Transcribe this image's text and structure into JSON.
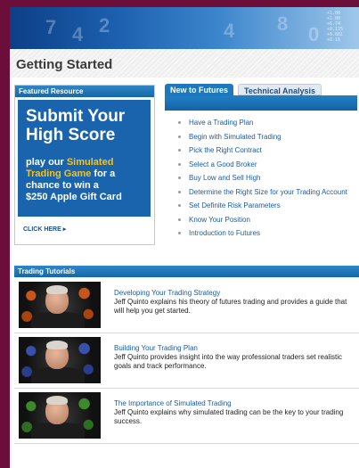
{
  "page_title": "Getting Started",
  "banner": {
    "ticker": [
      "+1.00",
      "+1.00",
      "+6.74",
      "+0.125",
      "+0.681",
      "+0.16"
    ]
  },
  "featured": {
    "header": "Featured Resource",
    "ad_line1": "Submit Your",
    "ad_line2": "High Score",
    "ad_pre": "play our ",
    "ad_highlight1": "Simulated",
    "ad_highlight2": "Trading Game",
    "ad_post1": " for a",
    "ad_post2": "chance to win a",
    "ad_post3": "$250 Apple Gift Card",
    "click_label": "CLICK HERE"
  },
  "tabs": [
    {
      "label": "New to Futures",
      "active": true
    },
    {
      "label": "Technical Analysis",
      "active": false
    }
  ],
  "links": [
    "Have a Trading Plan",
    "Begin with Simulated Trading",
    "Pick the Right Contract",
    "Select a Good Broker",
    "Buy Low and Sell High",
    "Determine the Right Size for your Trading Account",
    "Set Definite Risk Parameters",
    "Know Your Position",
    "Introduction to Futures"
  ],
  "tutorials": {
    "header": "Trading Tutorials",
    "items": [
      {
        "title": "Developing Your Trading Strategy",
        "description": "Jeff Quinto explains his theory of futures trading and provides a guide that will help you get started.",
        "thumb_color": "#c8561c"
      },
      {
        "title": "Building Your Trading Plan",
        "description": "Jeff Quinto provides insight into the way professional traders set realistic goals and track performance.",
        "thumb_color": "#3a4fa8"
      },
      {
        "title": "The Importance of Simulated Trading",
        "description": "Jeff Quinto explains why simulated trading can be the key to your trading success.",
        "thumb_color": "#3d8a2e"
      }
    ]
  }
}
